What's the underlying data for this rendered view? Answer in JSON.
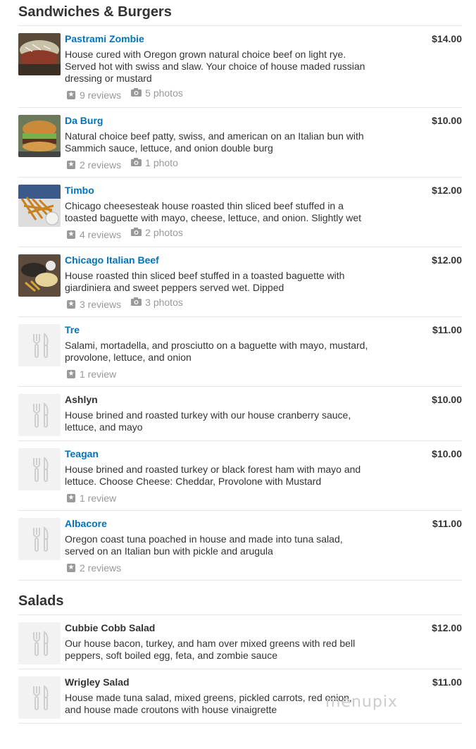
{
  "sections": [
    {
      "title": "Sandwiches & Burgers",
      "items": [
        {
          "name": "Pastrami Zombie",
          "link": true,
          "price": "$14.00",
          "desc": "House cured with Oregon grown natural choice beef on light rye. Served hot with swiss and slaw. Your choice of house maded russian dressing or mustard",
          "reviews": "9 reviews",
          "photos": "5 photos",
          "thumb": "photo-sandwich-slaw"
        },
        {
          "name": "Da Burg",
          "link": true,
          "price": "$10.00",
          "desc": "Natural choice beef patty, swiss, and american on an Italian bun with Sammich sauce, lettuce, and onion double burg",
          "reviews": "2 reviews",
          "photos": "1 photo",
          "thumb": "photo-burger"
        },
        {
          "name": "Timbo",
          "link": true,
          "price": "$12.00",
          "desc": "Chicago cheesesteak house roasted thin sliced beef stuffed in a toasted baguette with mayo, cheese, lettuce, and onion. Slightly wet",
          "reviews": "4 reviews",
          "photos": "2 photos",
          "thumb": "photo-fries"
        },
        {
          "name": "Chicago Italian Beef",
          "link": true,
          "price": "$12.00",
          "desc": "House roasted thin sliced beef stuffed in a toasted baguette with giardiniera and sweet peppers served wet. Dipped",
          "reviews": "3 reviews",
          "photos": "3 photos",
          "thumb": "photo-italian-beef"
        },
        {
          "name": "Tre",
          "link": true,
          "price": "$11.00",
          "desc": "Salami, mortadella, and prosciutto on a baguette with mayo, mustard, provolone, lettuce, and onion",
          "reviews": "1 review",
          "photos": "",
          "thumb": "utensils-icon"
        },
        {
          "name": "Ashlyn",
          "link": false,
          "price": "$10.00",
          "desc": "House brined and roasted turkey with our house cranberry sauce, lettuce, and mayo",
          "reviews": "",
          "photos": "",
          "thumb": "utensils-icon"
        },
        {
          "name": "Teagan",
          "link": true,
          "price": "$10.00",
          "desc": "House brined and roasted turkey or black forest ham with mayo and lettuce. Choose Cheese: Cheddar, Provolone with Mustard",
          "reviews": "1 review",
          "photos": "",
          "thumb": "utensils-icon"
        },
        {
          "name": "Albacore",
          "link": true,
          "price": "$11.00",
          "desc": "Oregon coast tuna poached in house and made into tuna salad, served on an Italian bun with pickle and arugula",
          "reviews": "2 reviews",
          "photos": "",
          "thumb": "utensils-icon"
        }
      ]
    },
    {
      "title": "Salads",
      "items": [
        {
          "name": "Cubbie Cobb Salad",
          "link": false,
          "price": "$12.00",
          "desc": "Our house bacon, turkey, and ham over mixed greens with red bell peppers, soft boiled egg, feta, and zombie sauce",
          "reviews": "",
          "photos": "",
          "thumb": "utensils-icon"
        },
        {
          "name": "Wrigley Salad",
          "link": false,
          "price": "$11.00",
          "desc": "House made tuna salad, mixed greens, pickled carrots, red onion, and house made croutons with house vinaigrette",
          "reviews": "",
          "photos": "",
          "thumb": "utensils-icon"
        }
      ]
    }
  ],
  "watermark": "menupix",
  "colors": {
    "link": "#0073bb",
    "text": "#333333",
    "muted": "#999999",
    "divider": "#e6e6e6"
  }
}
